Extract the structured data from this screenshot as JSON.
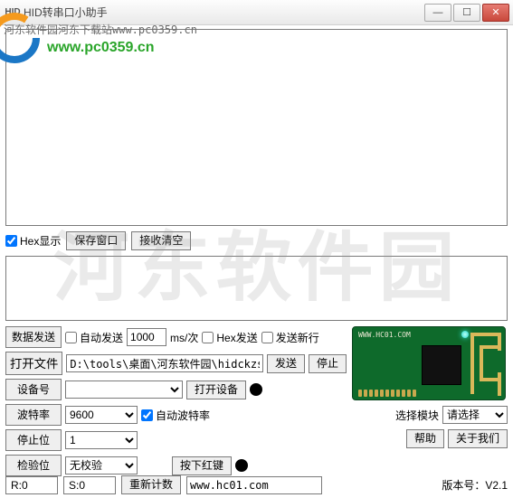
{
  "window": {
    "icon_label": "HID",
    "title": "HID转串口小助手",
    "min": "—",
    "max": "☐",
    "close": "✕"
  },
  "watermark": {
    "url_line": "河东软件园河东下载站www.pc0359.cn",
    "url_big": "www.pc0359.cn",
    "center_text": "河东软件园"
  },
  "recv": {
    "hex_display": "Hex显示",
    "hex_checked": true,
    "save_window": "保存窗口",
    "recv_clear": "接收清空"
  },
  "send_row": {
    "label": "数据发送",
    "auto_send": "自动发送",
    "auto_send_checked": false,
    "interval_value": "1000",
    "interval_unit": "ms/次",
    "hex_send": "Hex发送",
    "hex_send_checked": false,
    "send_newline": "发送新行",
    "send_newline_checked": false
  },
  "file_row": {
    "label": "打开文件",
    "path_value": "D:\\tools\\桌面\\河东软件园\\hidckzssah",
    "send": "发送",
    "stop": "停止"
  },
  "device_row": {
    "label": "设备号",
    "value": "",
    "open_device": "打开设备"
  },
  "baud_row": {
    "label": "波特率",
    "value": "9600",
    "auto_baud": "自动波特率",
    "auto_baud_checked": true
  },
  "stopbit_row": {
    "label": "停止位",
    "value": "1"
  },
  "parity_row": {
    "label": "检验位",
    "value": "无校验",
    "press_red": "按下红键"
  },
  "module": {
    "silk": "WWW.HC01.COM",
    "select_module": "选择模块",
    "placeholder": "请选择",
    "help": "帮助",
    "about": "关于我们"
  },
  "status": {
    "r": "R:0",
    "s": "S:0",
    "recount": "重新计数",
    "url": "www.hc01.com",
    "version": "版本号：V2.1"
  }
}
